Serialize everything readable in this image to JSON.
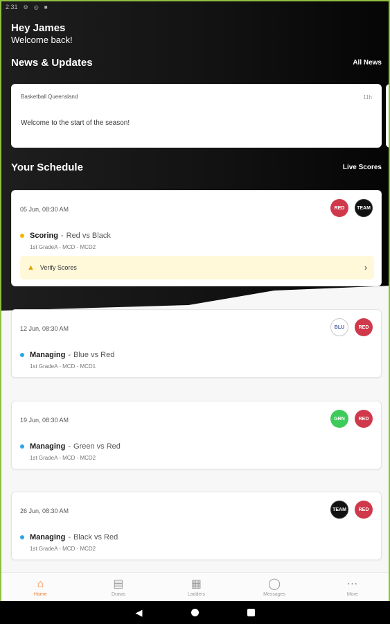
{
  "status_bar": {
    "time": "2:31"
  },
  "greeting": {
    "title": "Hey James",
    "subtitle": "Welcome back!"
  },
  "news": {
    "heading": "News & Updates",
    "all_link": "All News",
    "items": [
      {
        "source": "Basketball Queensland",
        "age": "11h",
        "message": "Welcome to the start of the season!"
      }
    ]
  },
  "schedule": {
    "heading": "Your Schedule",
    "live_link": "Live Scores",
    "games": [
      {
        "date": "05 Jun, 08:30 AM",
        "role": "Scoring",
        "matchup": "Red vs Black",
        "details": "1st GradeA - MCD - MCD2",
        "status_color": "#f5b400",
        "logos": [
          "RED",
          "TEAM"
        ],
        "verify": {
          "label": "Verify Scores"
        }
      },
      {
        "date": "12 Jun, 08:30 AM",
        "role": "Managing",
        "matchup": "Blue vs Red",
        "details": "1st GradeA - MCD - MCD1",
        "status_color": "#2aa7e8",
        "logos": [
          "BLU",
          "RED"
        ]
      },
      {
        "date": "19 Jun, 08:30 AM",
        "role": "Managing",
        "matchup": "Green vs Red",
        "details": "1st GradeA - MCD - MCD2",
        "status_color": "#2aa7e8",
        "logos": [
          "GRN",
          "RED"
        ]
      },
      {
        "date": "26 Jun, 08:30 AM",
        "role": "Managing",
        "matchup": "Black vs Red",
        "details": "1st GradeA - MCD - MCD2",
        "status_color": "#2aa7e8",
        "logos": [
          "TEAM",
          "RED"
        ]
      }
    ]
  },
  "bottom_nav": [
    {
      "label": "Home",
      "icon": "home-icon",
      "active": true
    },
    {
      "label": "Draws",
      "icon": "calendar-list-icon",
      "active": false
    },
    {
      "label": "Ladders",
      "icon": "ladder-icon",
      "active": false
    },
    {
      "label": "Messages",
      "icon": "chat-bubble-icon",
      "active": false
    },
    {
      "label": "More",
      "icon": "more-dots-icon",
      "active": false
    }
  ],
  "colors": {
    "accent": "#ef7a2e",
    "scoring": "#f5b400",
    "managing": "#2aa7e8",
    "verify_bg": "#fff8d9"
  }
}
